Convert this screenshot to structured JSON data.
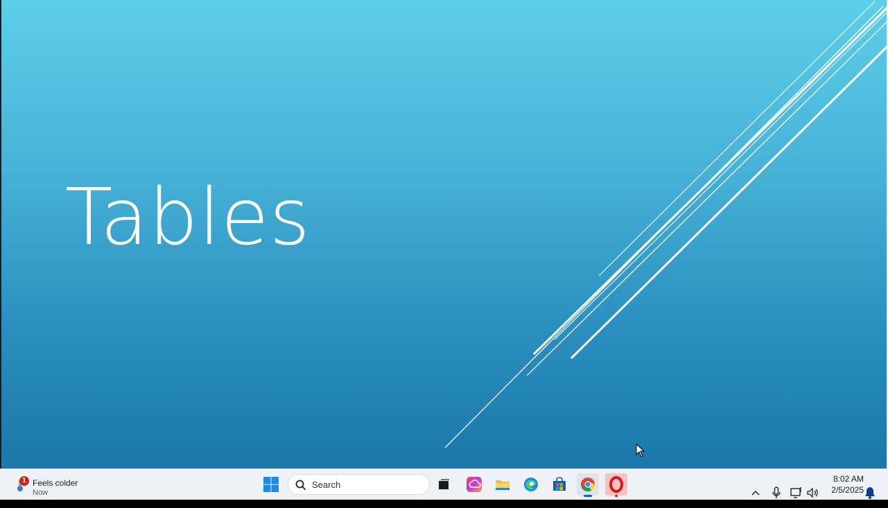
{
  "slide": {
    "title": "Tables"
  },
  "taskbar": {
    "weather": {
      "badge": "1",
      "headline": "Feels colder",
      "sub": "Now"
    },
    "search": {
      "placeholder": "Search"
    },
    "pinned": [
      "task-view-icon",
      "creative-cloud-icon",
      "file-explorer-icon",
      "edge-icon",
      "store-icon",
      "chrome-icon",
      "opera-icon"
    ],
    "clock": {
      "time": "8:02 AM",
      "date": "2/5/2025"
    }
  },
  "colors": {
    "accent": "#0067c0",
    "slide_top": "#5ccfe9",
    "slide_bottom": "#1a77aa"
  }
}
